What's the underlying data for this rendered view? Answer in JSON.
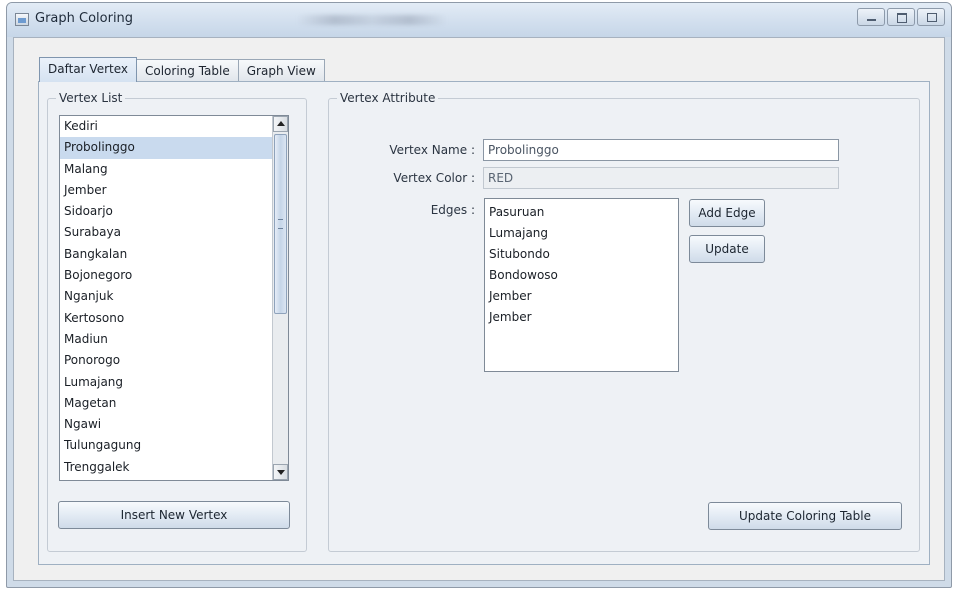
{
  "window": {
    "title": "Graph Coloring"
  },
  "tabs": [
    {
      "label": "Daftar Vertex",
      "active": true
    },
    {
      "label": "Coloring Table",
      "active": false
    },
    {
      "label": "Graph View",
      "active": false
    }
  ],
  "vertex_list": {
    "title": "Vertex List",
    "items": [
      "Kediri",
      "Probolinggo",
      "Malang",
      "Jember",
      "Sidoarjo",
      "Surabaya",
      "Bangkalan",
      "Bojonegoro",
      "Nganjuk",
      "Kertosono",
      "Madiun",
      "Ponorogo",
      "Lumajang",
      "Magetan",
      "Ngawi",
      "Tulungagung",
      "Trenggalek"
    ],
    "selected": "Probolinggo",
    "insert_button": "Insert New Vertex"
  },
  "vertex_attribute": {
    "title": "Vertex Attribute",
    "name_label": "Vertex Name :",
    "name_value": "Probolinggo",
    "color_label": "Vertex Color :",
    "color_value": "RED",
    "edges_label": "Edges :",
    "edges": [
      "Pasuruan",
      "Lumajang",
      "Situbondo",
      "Bondowoso",
      "Jember",
      "Jember"
    ],
    "add_edge_button": "Add Edge",
    "update_button": "Update",
    "update_table_button": "Update Coloring Table"
  },
  "colors": {
    "selection": "#c9daee",
    "window_frame": "#cfdbe8",
    "panel_bg": "#eef1f5"
  }
}
